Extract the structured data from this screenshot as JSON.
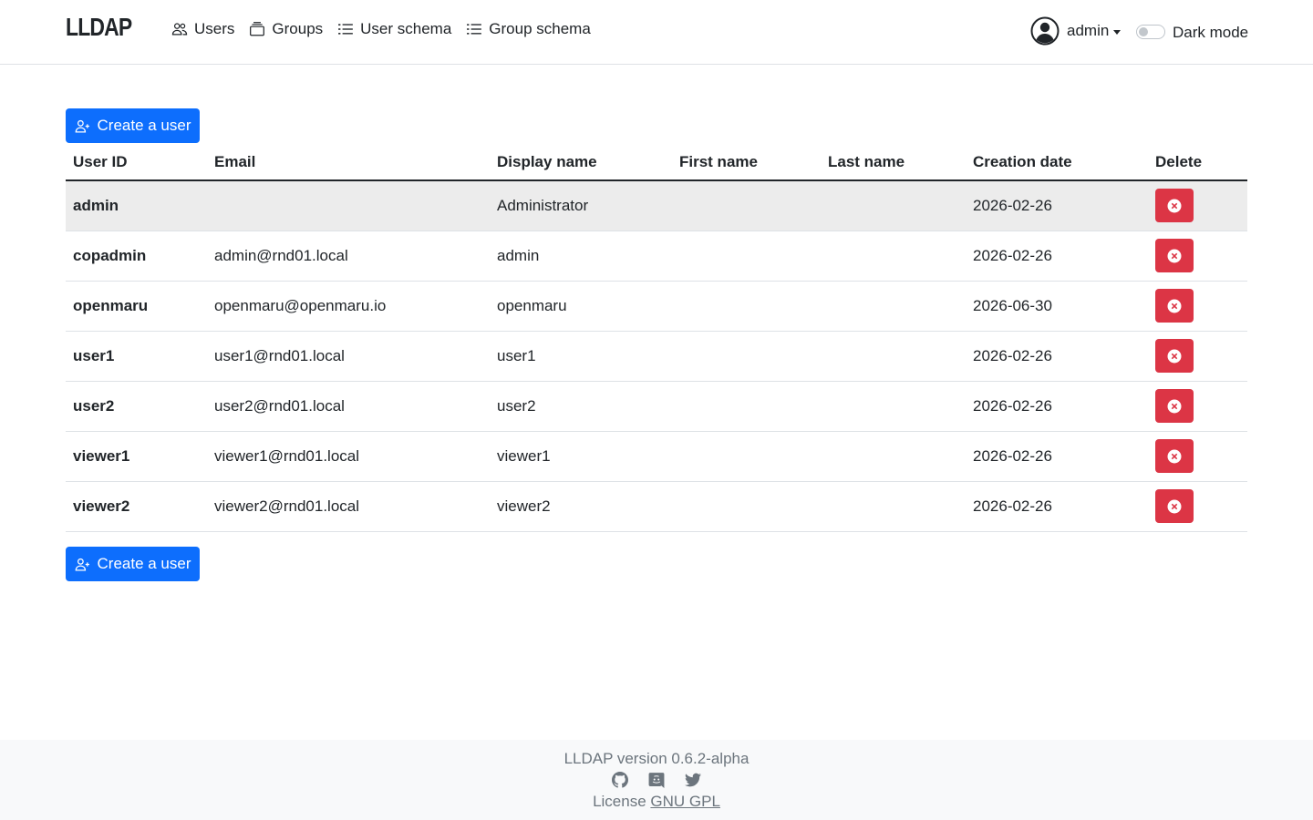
{
  "header": {
    "brand": "LLDAP",
    "nav": [
      {
        "label": "Users",
        "icon": "people-icon"
      },
      {
        "label": "Groups",
        "icon": "collection-icon"
      },
      {
        "label": "User schema",
        "icon": "list-icon"
      },
      {
        "label": "Group schema",
        "icon": "list-icon"
      }
    ],
    "user": {
      "name": "admin",
      "icon": "person-circle-icon"
    },
    "dark_mode": {
      "label": "Dark mode",
      "enabled": false
    }
  },
  "actions": {
    "create_user_label": "Create a user"
  },
  "table": {
    "columns": [
      "User ID",
      "Email",
      "Display name",
      "First name",
      "Last name",
      "Creation date",
      "Delete"
    ],
    "rows": [
      {
        "user_id": "admin",
        "email": "",
        "display_name": "Administrator",
        "first_name": "",
        "last_name": "",
        "creation_date": "2026-02-26"
      },
      {
        "user_id": "copadmin",
        "email": "admin@rnd01.local",
        "display_name": "admin",
        "first_name": "",
        "last_name": "",
        "creation_date": "2026-02-26"
      },
      {
        "user_id": "openmaru",
        "email": "openmaru@openmaru.io",
        "display_name": "openmaru",
        "first_name": "",
        "last_name": "",
        "creation_date": "2026-06-30"
      },
      {
        "user_id": "user1",
        "email": "user1@rnd01.local",
        "display_name": "user1",
        "first_name": "",
        "last_name": "",
        "creation_date": "2026-02-26"
      },
      {
        "user_id": "user2",
        "email": "user2@rnd01.local",
        "display_name": "user2",
        "first_name": "",
        "last_name": "",
        "creation_date": "2026-02-26"
      },
      {
        "user_id": "viewer1",
        "email": "viewer1@rnd01.local",
        "display_name": "viewer1",
        "first_name": "",
        "last_name": "",
        "creation_date": "2026-02-26"
      },
      {
        "user_id": "viewer2",
        "email": "viewer2@rnd01.local",
        "display_name": "viewer2",
        "first_name": "",
        "last_name": "",
        "creation_date": "2026-02-26"
      }
    ]
  },
  "footer": {
    "version": "LLDAP version 0.6.2-alpha",
    "license_prefix": "License",
    "license_link": "GNU GPL",
    "social_icons": [
      "github-icon",
      "discord-icon",
      "twitter-icon"
    ]
  },
  "colors": {
    "primary": "#0d6efd",
    "danger": "#dc3545",
    "highlight_row": "#ececec",
    "footer_bg": "#f8f9fa"
  }
}
